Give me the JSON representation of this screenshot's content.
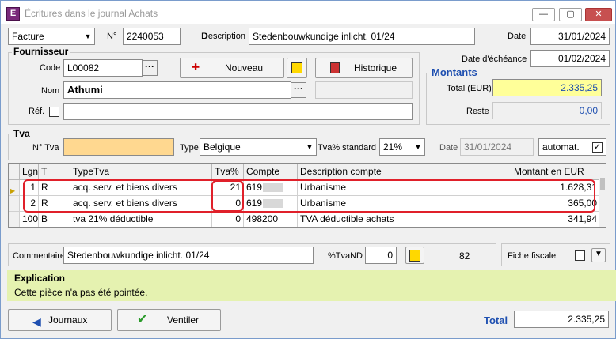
{
  "window": {
    "title": "Écritures dans le journal Achats",
    "minimize": "—",
    "maximize": "▢",
    "close": "✕",
    "app_icon": "E"
  },
  "header": {
    "doc_type": "Facture",
    "num_label": "N°",
    "num_value": "2240053",
    "description_label": "Description",
    "description_value": "Stedenbouwkundige inlicht. 01/24",
    "date_label": "Date",
    "date_value": "31/01/2024",
    "due_label": "Date d'échéance",
    "due_value": "01/02/2024"
  },
  "fournisseur": {
    "title": "Fournisseur",
    "code_label": "Code",
    "code_value": "L00082",
    "nom_label": "Nom",
    "nom_value": "Athumi",
    "ref_label": "Réf.",
    "ref_value": "",
    "nouveau_label": "Nouveau",
    "historique_label": "Historique"
  },
  "montants": {
    "title": "Montants",
    "total_label": "Total (EUR)",
    "total_value": "2.335,25",
    "reste_label": "Reste",
    "reste_value": "0,00"
  },
  "tva": {
    "title": "Tva",
    "num_label": "N° Tva",
    "num_value": "",
    "type_label": "Type",
    "type_value": "Belgique",
    "std_label": "Tva% standard",
    "std_value": "21%",
    "date_label": "Date",
    "date_value": "31/01/2024",
    "automat_label": "automat.",
    "automat_checked": "✓"
  },
  "grid": {
    "columns": [
      "Lgn",
      "T",
      "TypeTva",
      "Tva%",
      "Compte",
      "Description compte",
      "Montant en EUR"
    ],
    "rows": [
      {
        "lgn": "1",
        "t": "R",
        "typetva": "acq. serv. et biens divers",
        "tva": "21",
        "compte": "619",
        "desc": "Urbanisme",
        "montant": "1.628,31"
      },
      {
        "lgn": "2",
        "t": "R",
        "typetva": "acq. serv. et biens divers",
        "tva": "0",
        "compte": "619",
        "desc": "Urbanisme",
        "montant": "365,00"
      },
      {
        "lgn": "100",
        "t": "B",
        "typetva": "tva 21% déductible",
        "tva": "0",
        "compte": "498200",
        "desc": "TVA déductible achats",
        "montant": "341,94"
      }
    ]
  },
  "footer": {
    "commentaire_label": "Commentaire",
    "commentaire_value": "Stedenbouwkundige inlicht. 01/24",
    "tvand_label": "%TvaND",
    "tvand_value": "0",
    "count_value": "82",
    "fiche_label": "Fiche fiscale"
  },
  "explication": {
    "title": "Explication",
    "text": "Cette pièce n'a pas été pointée."
  },
  "bottom": {
    "journaux_label": "Journaux",
    "ventiler_label": "Ventiler",
    "total_label": "Total",
    "total_value": "2.335,25"
  },
  "colors": {
    "accent_blue": "#1e4fb0",
    "highlight_yellow": "#ffff99",
    "tva_orange": "#ffd890",
    "expl_green": "#e5f2b0",
    "annotation_red": "#e0202a"
  }
}
